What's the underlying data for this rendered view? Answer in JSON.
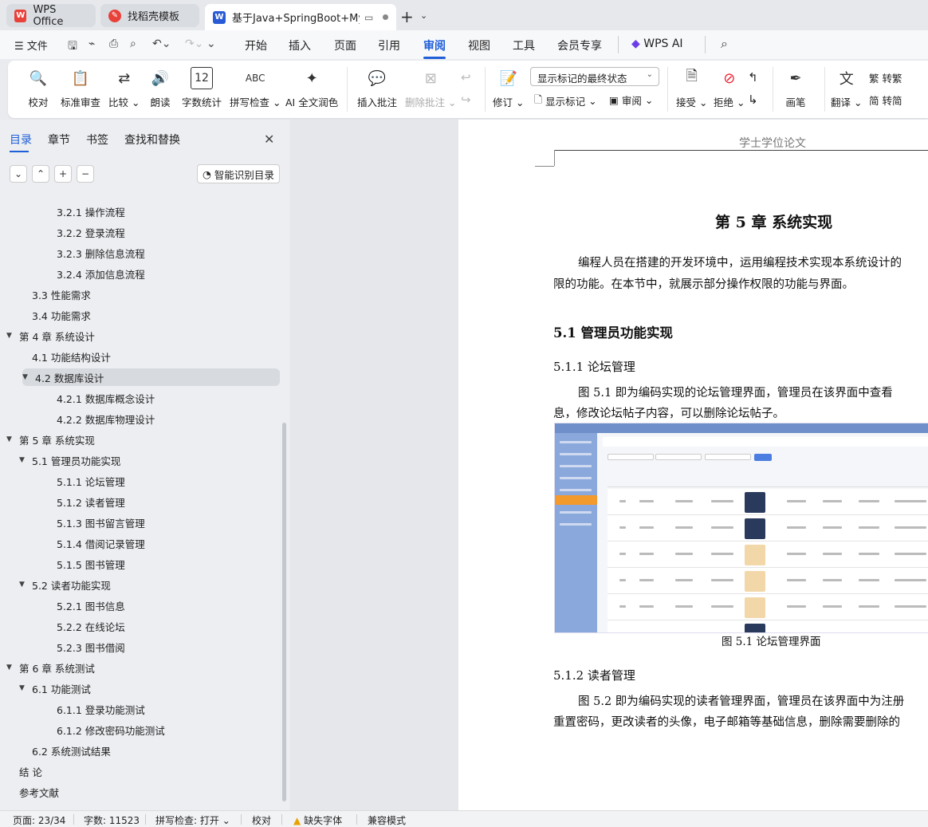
{
  "tabs": [
    {
      "label": "WPS Office",
      "color": "#e8413a"
    },
    {
      "label": "找稻壳模板",
      "color": "#e8413a"
    },
    {
      "label": "基于Java+SpringBoot+MyS",
      "color": "#2a5bd7"
    }
  ],
  "menu": {
    "file": "文件",
    "items": [
      "开始",
      "插入",
      "页面",
      "引用",
      "审阅",
      "视图",
      "工具",
      "会员专享",
      "WPS AI"
    ],
    "active": "审阅"
  },
  "ribbon": {
    "proofread": "校对",
    "standard_review": "标准审查",
    "compare": "比较",
    "read_aloud": "朗读",
    "word_count": "字数统计",
    "spell_check": "拼写检查",
    "ai_polish": "AI 全文润色",
    "insert_comment": "插入批注",
    "delete_comment": "删除批注",
    "revise": "修订",
    "markup_select": "显示标记的最终状态",
    "show_markup": "显示标记",
    "review": "审阅",
    "accept": "接受",
    "reject": "拒绝",
    "brush": "画笔",
    "translate": "翻译",
    "to_traditional": "转繁",
    "to_simplified": "转简"
  },
  "panel": {
    "tabs": [
      "目录",
      "章节",
      "书签",
      "查找和替换"
    ],
    "active_tab": "目录",
    "smart_toc": "智能识别目录",
    "toc": [
      {
        "label": "3.2.1  操作流程",
        "level": 3,
        "arrow": false
      },
      {
        "label": "3.2.2  登录流程",
        "level": 3,
        "arrow": false
      },
      {
        "label": "3.2.3  删除信息流程",
        "level": 3,
        "arrow": false
      },
      {
        "label": "3.2.4  添加信息流程",
        "level": 3,
        "arrow": false
      },
      {
        "label": "3.3  性能需求",
        "level": 2,
        "arrow": false
      },
      {
        "label": "3.4  功能需求",
        "level": 2,
        "arrow": false
      },
      {
        "label": "第 4 章  系统设计",
        "level": 1,
        "arrow": true
      },
      {
        "label": "4.1  功能结构设计",
        "level": 2,
        "arrow": false
      },
      {
        "label": "4.2  数据库设计",
        "level": 2,
        "arrow": true,
        "selected": true
      },
      {
        "label": "4.2.1  数据库概念设计",
        "level": 3,
        "arrow": false
      },
      {
        "label": "4.2.2  数据库物理设计",
        "level": 3,
        "arrow": false
      },
      {
        "label": "第 5 章  系统实现",
        "level": 1,
        "arrow": true
      },
      {
        "label": "5.1  管理员功能实现",
        "level": 2,
        "arrow": true
      },
      {
        "label": "5.1.1  论坛管理",
        "level": 3,
        "arrow": false
      },
      {
        "label": "5.1.2  读者管理",
        "level": 3,
        "arrow": false
      },
      {
        "label": "5.1.3  图书留言管理",
        "level": 3,
        "arrow": false
      },
      {
        "label": "5.1.4  借阅记录管理",
        "level": 3,
        "arrow": false
      },
      {
        "label": "5.1.5  图书管理",
        "level": 3,
        "arrow": false
      },
      {
        "label": "5.2  读者功能实现",
        "level": 2,
        "arrow": true
      },
      {
        "label": "5.2.1  图书信息",
        "level": 3,
        "arrow": false
      },
      {
        "label": "5.2.2  在线论坛",
        "level": 3,
        "arrow": false
      },
      {
        "label": "5.2.3  图书借阅",
        "level": 3,
        "arrow": false
      },
      {
        "label": "第 6 章  系统测试",
        "level": 1,
        "arrow": true
      },
      {
        "label": "6.1  功能测试",
        "level": 2,
        "arrow": true
      },
      {
        "label": "6.1.1  登录功能测试",
        "level": 3,
        "arrow": false
      },
      {
        "label": "6.1.2  修改密码功能测试",
        "level": 3,
        "arrow": false
      },
      {
        "label": "6.2  系统测试结果",
        "level": 2,
        "arrow": false
      },
      {
        "label": "结    论",
        "level": 1,
        "arrow": false
      },
      {
        "label": "参考文献",
        "level": 1,
        "arrow": false
      }
    ]
  },
  "doc": {
    "header": "学士学位论文",
    "chapter": "第 5 章  系统实现",
    "intro_line1": "编程人员在搭建的开发环境中，运用编程技术实现本系统设计的",
    "intro_line2": "限的功能。在本节中，就展示部分操作权限的功能与界面。",
    "sec_5_1": "5.1  管理员功能实现",
    "sec_5_1_1": "5.1.1  论坛管理",
    "p1_line1": "图 5.1 即为编码实现的论坛管理界面，管理员在该界面中查看",
    "p1_line2": "息，修改论坛帖子内容，可以删除论坛帖子。",
    "fig_caption": "图 5.1  论坛管理界面",
    "sec_5_1_2": "5.1.2  读者管理",
    "p2_line1": "图 5.2 即为编码实现的读者管理界面，管理员在该界面中为注册",
    "p2_line2": "重置密码，更改读者的头像，电子邮箱等基础信息，删除需要删除的"
  },
  "status": {
    "page": "页面: 23/34",
    "words": "字数: 11523",
    "spell": "拼写检查: 打开",
    "proof": "校对",
    "missing_font": "缺失字体",
    "compat": "兼容模式"
  }
}
